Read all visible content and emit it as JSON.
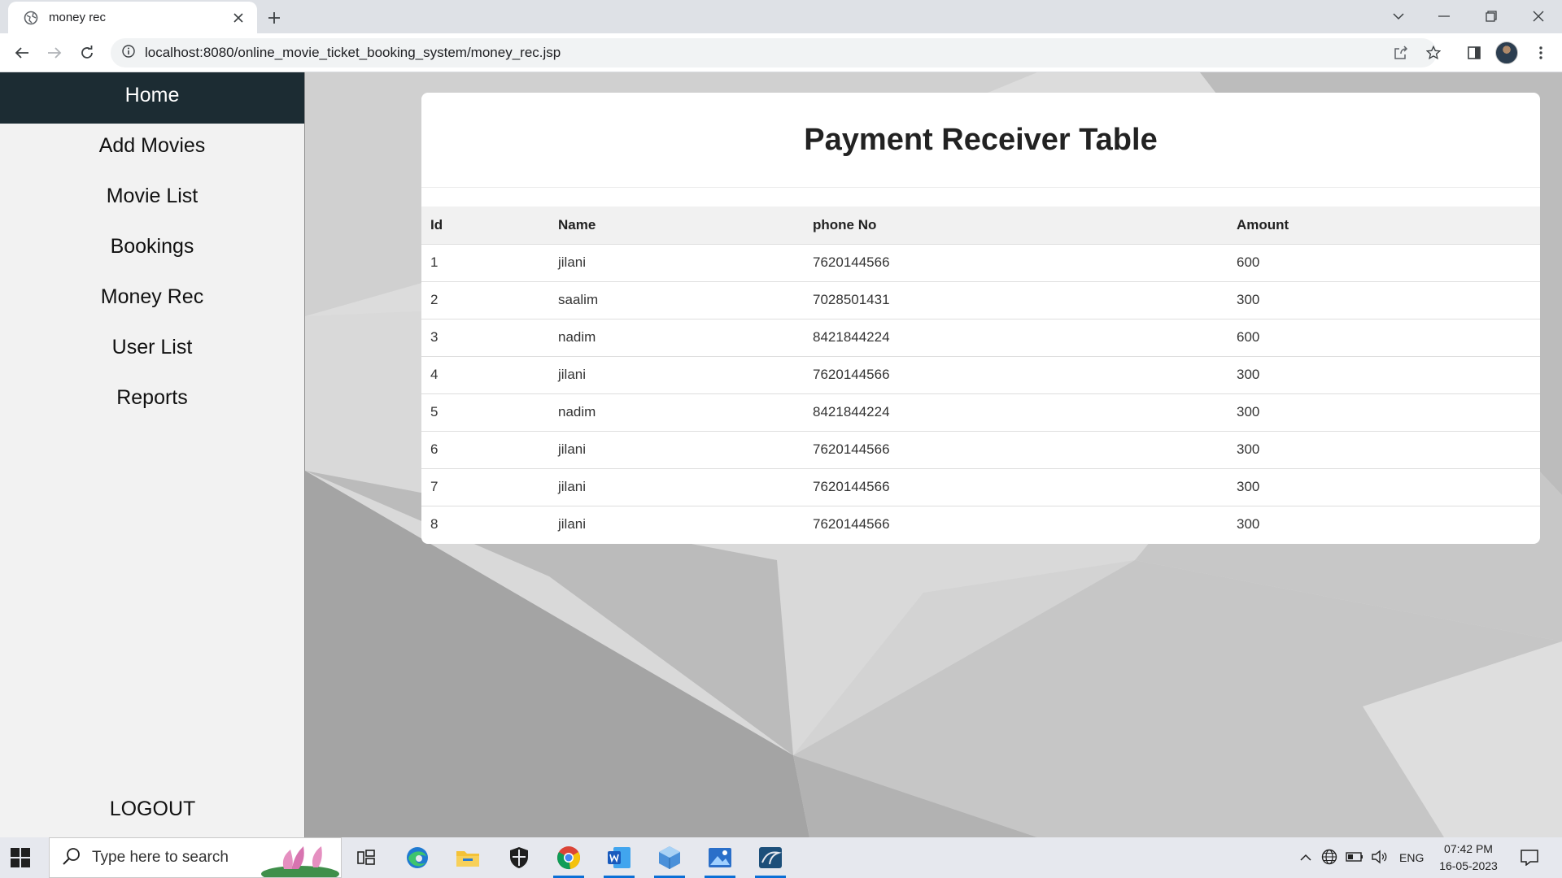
{
  "browser": {
    "tab_title": "money rec",
    "url": "localhost:8080/online_movie_ticket_booking_system/money_rec.jsp"
  },
  "sidebar": {
    "items": [
      {
        "label": "Home",
        "active": true
      },
      {
        "label": "Add Movies"
      },
      {
        "label": "Movie List"
      },
      {
        "label": "Bookings"
      },
      {
        "label": "Money Rec"
      },
      {
        "label": "User List"
      },
      {
        "label": "Reports"
      }
    ],
    "logout": "LOGOUT"
  },
  "main": {
    "title": "Payment Receiver Table",
    "table": {
      "headers": [
        "Id",
        "Name",
        "phone No",
        "Amount"
      ],
      "rows": [
        [
          "1",
          "jilani",
          "7620144566",
          "600"
        ],
        [
          "2",
          "saalim",
          "7028501431",
          "300"
        ],
        [
          "3",
          "nadim",
          "8421844224",
          "600"
        ],
        [
          "4",
          "jilani",
          "7620144566",
          "300"
        ],
        [
          "5",
          "nadim",
          "8421844224",
          "300"
        ],
        [
          "6",
          "jilani",
          "7620144566",
          "300"
        ],
        [
          "7",
          "jilani",
          "7620144566",
          "300"
        ],
        [
          "8",
          "jilani",
          "7620144566",
          "300"
        ]
      ]
    }
  },
  "taskbar": {
    "search_placeholder": "Type here to search",
    "language": "ENG",
    "time": "07:42 PM",
    "date": "16-05-2023"
  },
  "colors": {
    "sidebar_active_bg": "#1c2c33",
    "sidebar_bg": "#f2f2f2",
    "taskbar_accent": "#0a6fd6"
  }
}
